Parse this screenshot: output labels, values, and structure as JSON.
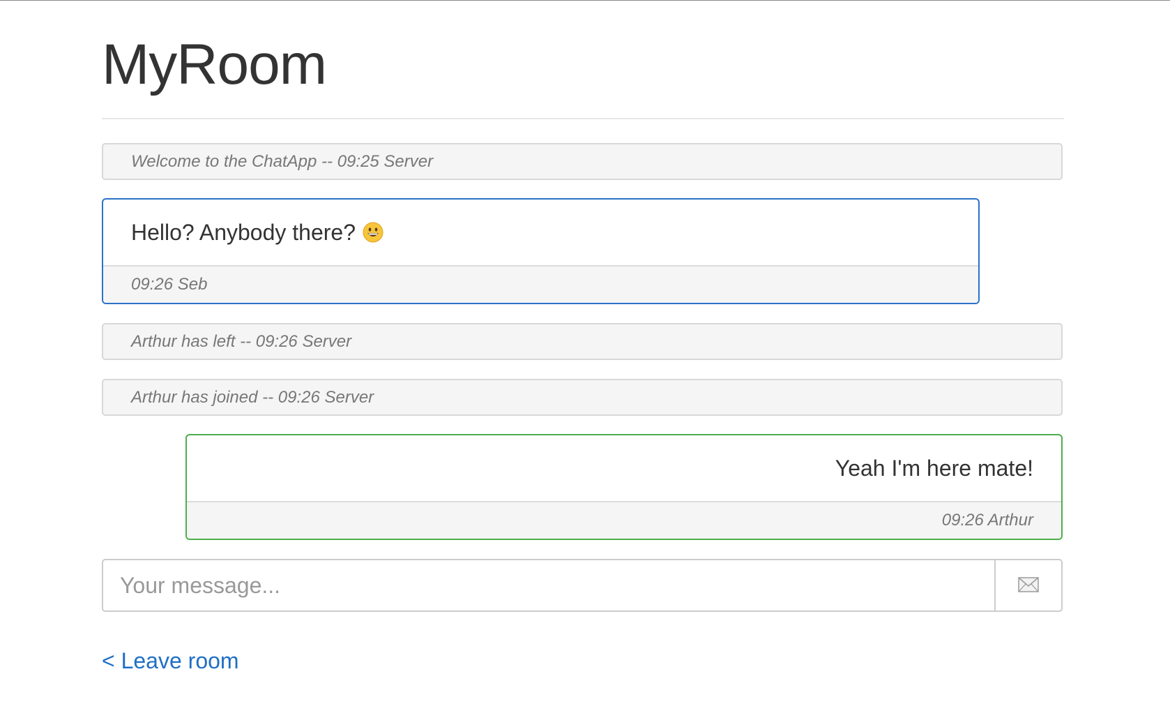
{
  "room": {
    "title": "MyRoom"
  },
  "messages": [
    {
      "type": "system",
      "text": "Welcome to the ChatApp -- 09:25 Server"
    },
    {
      "type": "own",
      "text": "Hello? Anybody there?",
      "emoji": "grinning-face",
      "meta": "09:26 Seb"
    },
    {
      "type": "system",
      "text": "Arthur has left -- 09:26 Server"
    },
    {
      "type": "system",
      "text": "Arthur has joined -- 09:26 Server"
    },
    {
      "type": "other",
      "text": "Yeah I'm here mate!",
      "meta": "09:26 Arthur"
    }
  ],
  "composer": {
    "placeholder": "Your message...",
    "value": "",
    "send_icon": "envelope-icon"
  },
  "nav": {
    "leave_label": "< Leave room"
  },
  "colors": {
    "own_border": "#2a72c9",
    "other_border": "#4cae4c",
    "link": "#1f6fc5",
    "system_bg": "#f5f5f5"
  }
}
